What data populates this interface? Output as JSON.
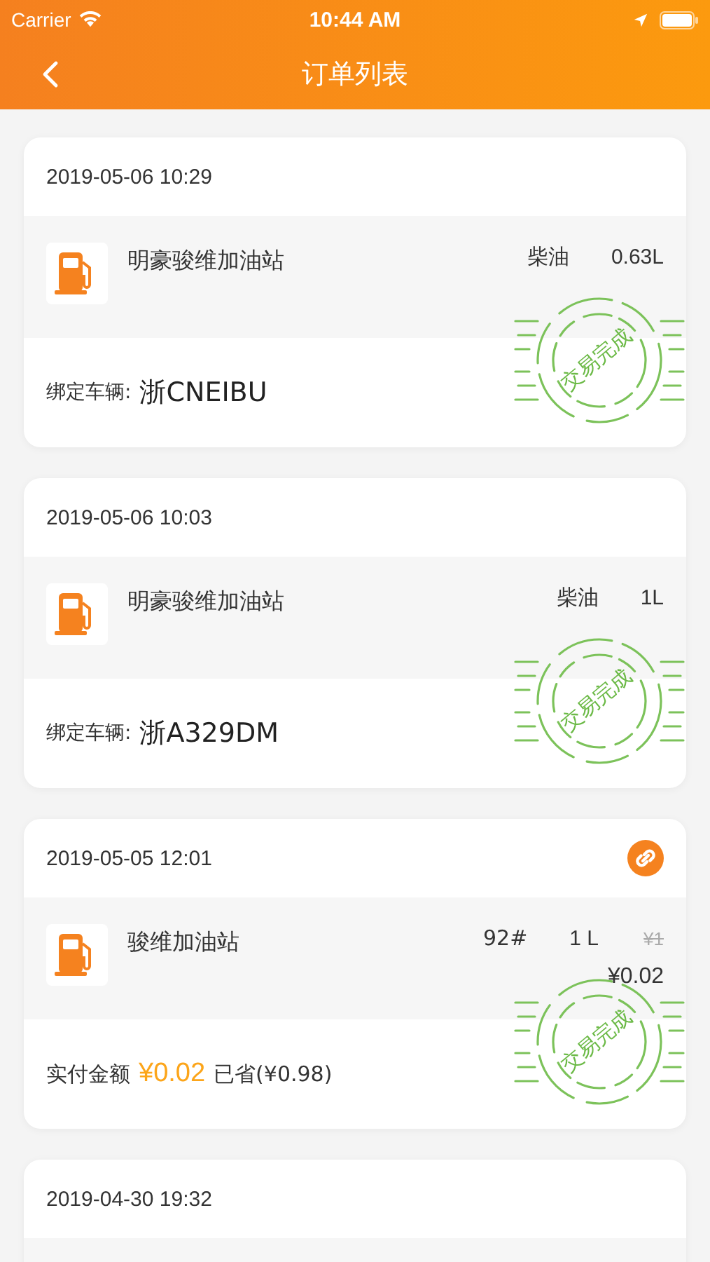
{
  "status_bar": {
    "carrier": "Carrier",
    "time": "10:44 AM"
  },
  "nav": {
    "title": "订单列表"
  },
  "orders": [
    {
      "kind": "vehicle",
      "date": "2019-05-06 10:29",
      "linked": false,
      "station": "明豪骏维加油站",
      "fuel": "柴油",
      "quantity": "0.63L",
      "label": "绑定车辆:",
      "plate": "浙CNEIBU",
      "stamp": "交易完成"
    },
    {
      "kind": "vehicle",
      "date": "2019-05-06 10:03",
      "linked": false,
      "station": "明豪骏维加油站",
      "fuel": "柴油",
      "quantity": "1L",
      "label": "绑定车辆:",
      "plate": "浙A329DM",
      "stamp": "交易完成"
    },
    {
      "kind": "payment",
      "date": "2019-05-05 12:01",
      "linked": true,
      "station": "骏维加油站",
      "fuel": "92#",
      "quantity": "1 L",
      "original_price": "¥1",
      "price": "¥0.02",
      "label": "实付金额",
      "amount": "¥0.02",
      "saved": "已省(¥0.98)",
      "stamp": "交易完成"
    },
    {
      "kind": "partial",
      "date": "2019-04-30 19:32",
      "linked": false
    }
  ]
}
